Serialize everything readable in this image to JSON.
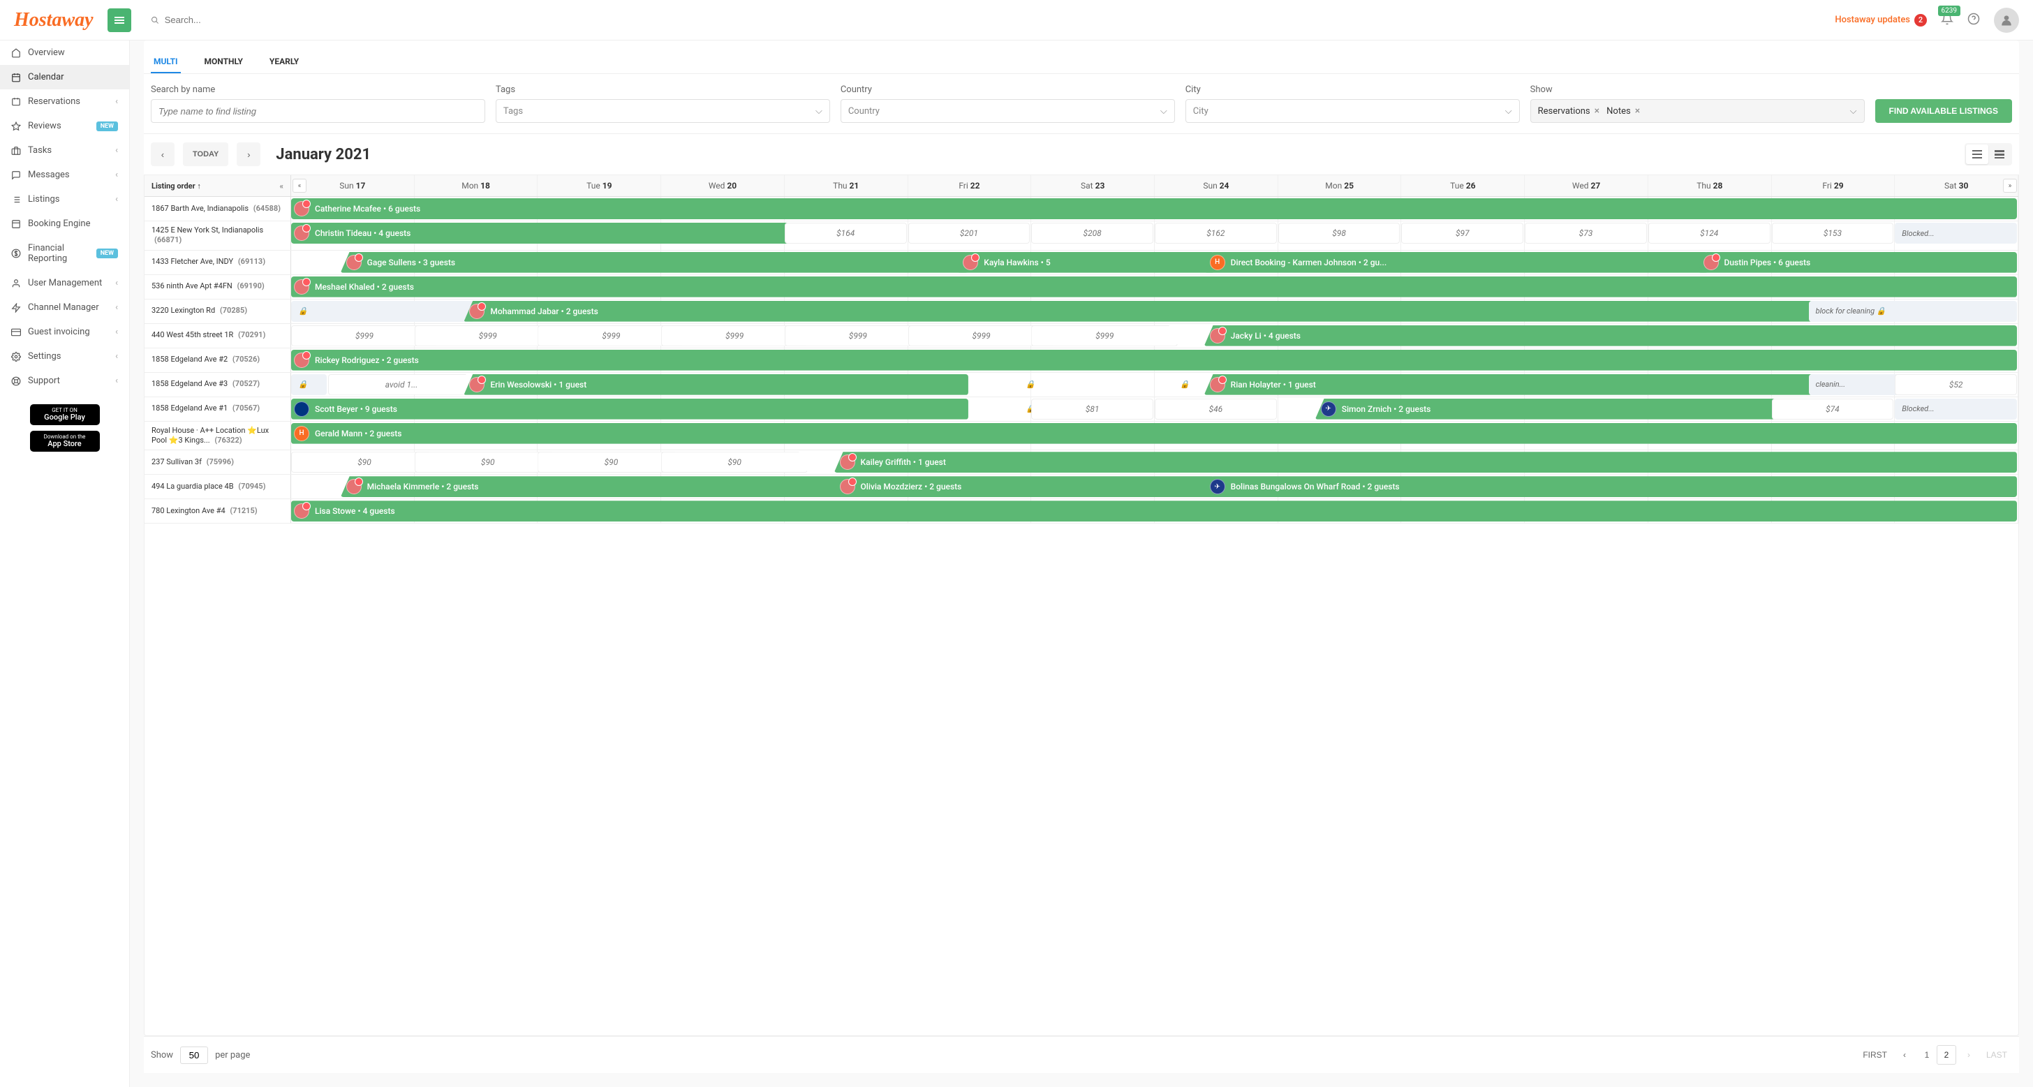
{
  "header": {
    "logo": "Hostaway",
    "search_placeholder": "Search...",
    "updates_label": "Hostaway updates",
    "updates_count": "2",
    "notif_count": "6239"
  },
  "sidebar": {
    "items": [
      {
        "label": "Overview",
        "icon": "home"
      },
      {
        "label": "Calendar",
        "icon": "calendar",
        "active": true
      },
      {
        "label": "Reservations",
        "icon": "book",
        "chevron": true
      },
      {
        "label": "Reviews",
        "icon": "star",
        "badge": "NEW"
      },
      {
        "label": "Tasks",
        "icon": "briefcase",
        "chevron": true
      },
      {
        "label": "Messages",
        "icon": "message",
        "chevron": true
      },
      {
        "label": "Listings",
        "icon": "list",
        "chevron": true
      },
      {
        "label": "Booking Engine",
        "icon": "window"
      },
      {
        "label": "Financial Reporting",
        "icon": "dollar",
        "badge": "NEW"
      },
      {
        "label": "User Management",
        "icon": "user",
        "chevron": true
      },
      {
        "label": "Channel Manager",
        "icon": "bolt",
        "chevron": true
      },
      {
        "label": "Guest invoicing",
        "icon": "card",
        "chevron": true
      },
      {
        "label": "Settings",
        "icon": "gear",
        "chevron": true
      },
      {
        "label": "Support",
        "icon": "life",
        "chevron": true
      }
    ],
    "google_play": "Google Play",
    "google_play_sub": "GET IT ON",
    "app_store": "App Store",
    "app_store_sub": "Download on the"
  },
  "tabs": [
    {
      "label": "MULTI",
      "active": true
    },
    {
      "label": "MONTHLY"
    },
    {
      "label": "YEARLY"
    }
  ],
  "filters": {
    "search_label": "Search by name",
    "search_placeholder": "Type name to find listing",
    "tags_label": "Tags",
    "tags_placeholder": "Tags",
    "country_label": "Country",
    "country_placeholder": "Country",
    "city_label": "City",
    "city_placeholder": "City",
    "show_label": "Show",
    "show_chips": [
      "Reservations",
      "Notes"
    ],
    "find_button": "FIND AVAILABLE LISTINGS"
  },
  "calendar": {
    "today_button": "TODAY",
    "title": "January 2021",
    "listing_header": "Listing order ↑",
    "dates": [
      {
        "dow": "Sun",
        "day": "17"
      },
      {
        "dow": "Mon",
        "day": "18"
      },
      {
        "dow": "Tue",
        "day": "19"
      },
      {
        "dow": "Wed",
        "day": "20"
      },
      {
        "dow": "Thu",
        "day": "21"
      },
      {
        "dow": "Fri",
        "day": "22"
      },
      {
        "dow": "Sat",
        "day": "23"
      },
      {
        "dow": "Sun",
        "day": "24"
      },
      {
        "dow": "Mon",
        "day": "25"
      },
      {
        "dow": "Tue",
        "day": "26"
      },
      {
        "dow": "Wed",
        "day": "27"
      },
      {
        "dow": "Thu",
        "day": "28"
      },
      {
        "dow": "Fri",
        "day": "29"
      },
      {
        "dow": "Sat",
        "day": "30"
      }
    ],
    "rows": [
      {
        "listing": "1867 Barth Ave, Indianapolis",
        "id": "(64588)",
        "items": [
          {
            "type": "booking",
            "start": 0,
            "span": 14,
            "label": "Catherine Mcafee • 6 guests",
            "startBefore": true
          }
        ]
      },
      {
        "listing": "1425 E New York St, Indianapolis",
        "id": "(66871)",
        "items": [
          {
            "type": "booking",
            "start": 0,
            "span": 4.5,
            "label": "Christin Tideau • 4 guests",
            "startBefore": true
          },
          {
            "type": "price",
            "start": 4,
            "span": 1,
            "label": "$164",
            "plain": true
          },
          {
            "type": "price",
            "start": 5,
            "span": 1,
            "label": "$201",
            "plain": true
          },
          {
            "type": "price",
            "start": 6,
            "span": 1,
            "label": "$208",
            "plain": true
          },
          {
            "type": "price",
            "start": 7,
            "span": 1,
            "label": "$162",
            "plain": true
          },
          {
            "type": "price",
            "start": 8,
            "span": 1,
            "label": "$98",
            "plain": true
          },
          {
            "type": "price",
            "start": 9,
            "span": 1,
            "label": "$97",
            "plain": true
          },
          {
            "type": "price",
            "start": 10,
            "span": 1,
            "label": "$73",
            "plain": true
          },
          {
            "type": "price",
            "start": 11,
            "span": 1,
            "label": "$124",
            "plain": true
          },
          {
            "type": "price",
            "start": 12,
            "span": 1,
            "label": "$153",
            "plain": true
          },
          {
            "type": "note",
            "start": 13,
            "span": 1,
            "label": "Blocked..."
          }
        ]
      },
      {
        "listing": "1433 Fletcher Ave, INDY",
        "id": "(69113)",
        "items": [
          {
            "type": "booking",
            "start": 0.4,
            "span": 5.1,
            "label": "Gage Sullens • 3 guests"
          },
          {
            "type": "booking",
            "start": 5.4,
            "span": 2.1,
            "label": "Kayla Hawkins • 5"
          },
          {
            "type": "booking",
            "start": 7.4,
            "span": 4.1,
            "label": "Direct Booking - Karmen Johnson • 2 gu...",
            "avatar": "h"
          },
          {
            "type": "booking",
            "start": 11.4,
            "span": 2.6,
            "label": "Dustin Pipes • 6 guests"
          }
        ]
      },
      {
        "listing": "536 ninth Ave Apt #4FN",
        "id": "(69190)",
        "items": [
          {
            "type": "booking",
            "start": 0,
            "span": 14,
            "label": "Meshael Khaled • 2 guests",
            "startBefore": true
          }
        ]
      },
      {
        "listing": "3220 Lexington Rd",
        "id": "(70285)",
        "items": [
          {
            "type": "note",
            "start": 0,
            "span": 1.5,
            "label": "🔒"
          },
          {
            "type": "booking",
            "start": 1.4,
            "span": 10.95,
            "label": "Mohammad Jabar • 2 guests"
          },
          {
            "type": "note",
            "start": 12.3,
            "span": 1.7,
            "label": "block for cleaning  🔒"
          }
        ]
      },
      {
        "listing": "440 West 45th street 1R",
        "id": "(70291)",
        "items": [
          {
            "type": "price",
            "start": 0,
            "span": 1.2,
            "label": "$999"
          },
          {
            "type": "price",
            "start": 1,
            "span": 1.2,
            "label": "$999"
          },
          {
            "type": "price",
            "start": 2,
            "span": 1.2,
            "label": "$999"
          },
          {
            "type": "price",
            "start": 3,
            "span": 1.2,
            "label": "$999"
          },
          {
            "type": "price",
            "start": 4,
            "span": 1.2,
            "label": "$999"
          },
          {
            "type": "price",
            "start": 5,
            "span": 1.2,
            "label": "$999"
          },
          {
            "type": "price",
            "start": 6,
            "span": 1.2,
            "label": "$999"
          },
          {
            "type": "booking",
            "start": 7.4,
            "span": 6.6,
            "label": "Jacky Li • 4 guests"
          }
        ]
      },
      {
        "listing": "1858 Edgeland Ave #2",
        "id": "(70526)",
        "items": [
          {
            "type": "booking",
            "start": 0,
            "span": 14,
            "label": "Rickey Rodriguez • 2 guests",
            "startBefore": true
          }
        ]
      },
      {
        "listing": "1858 Edgeland Ave #3",
        "id": "(70527)",
        "items": [
          {
            "type": "note",
            "start": 0,
            "span": 0.3,
            "label": "🔒"
          },
          {
            "type": "price",
            "start": 0.3,
            "span": 1.2,
            "label": "avoid 1..."
          },
          {
            "type": "booking",
            "start": 1.4,
            "span": 4.1,
            "label": "Erin Wesolowski • 1 guest"
          },
          {
            "type": "note",
            "start": 5.5,
            "span": 1,
            "label": "🔒",
            "plain": true
          },
          {
            "type": "note",
            "start": 7,
            "span": 0.5,
            "label": "🔒",
            "plain": true
          },
          {
            "type": "booking",
            "start": 7.4,
            "span": 4.95,
            "label": "Rian Holayter • 1 guest"
          },
          {
            "type": "note",
            "start": 12.3,
            "span": 0.8,
            "label": "cleanin..."
          },
          {
            "type": "price",
            "start": 13,
            "span": 1,
            "label": "$52",
            "plain": true
          }
        ]
      },
      {
        "listing": "1858 Edgeland Ave #1",
        "id": "(70567)",
        "items": [
          {
            "type": "booking",
            "start": 0,
            "span": 5.5,
            "label": "Scott Beyer • 9 guests",
            "startBefore": true,
            "avatar": "ex"
          },
          {
            "type": "note",
            "start": 5.5,
            "span": 1,
            "label": "🔒",
            "plain": true
          },
          {
            "type": "price",
            "start": 6,
            "span": 1,
            "label": "$81",
            "plain": true
          },
          {
            "type": "price",
            "start": 7,
            "span": 1,
            "label": "$46",
            "plain": true
          },
          {
            "type": "booking",
            "start": 8.3,
            "span": 4,
            "label": "Simon Zrnich • 2 guests",
            "avatar": "blue"
          },
          {
            "type": "price",
            "start": 12,
            "span": 1,
            "label": "$74",
            "plain": true
          },
          {
            "type": "note",
            "start": 13,
            "span": 1,
            "label": "Blocked..."
          }
        ]
      },
      {
        "listing": "Royal House · A++ Location ⭐Lux Pool ⭐3 Kings...",
        "id": "(76322)",
        "items": [
          {
            "type": "booking",
            "start": 0,
            "span": 14,
            "label": "Gerald Mann • 2 guests",
            "startBefore": true,
            "avatar": "h"
          }
        ]
      },
      {
        "listing": "237 Sullivan 3f",
        "id": "(75996)",
        "items": [
          {
            "type": "price",
            "start": 0,
            "span": 1.2,
            "label": "$90"
          },
          {
            "type": "price",
            "start": 1,
            "span": 1.2,
            "label": "$90"
          },
          {
            "type": "price",
            "start": 2,
            "span": 1.2,
            "label": "$90"
          },
          {
            "type": "price",
            "start": 3,
            "span": 1.2,
            "label": "$90"
          },
          {
            "type": "booking",
            "start": 4.4,
            "span": 9.6,
            "label": "Kailey Griffith • 1 guest"
          }
        ]
      },
      {
        "listing": "494 La guardia place 4B",
        "id": "(70945)",
        "items": [
          {
            "type": "booking",
            "start": 0.4,
            "span": 4.1,
            "label": "Michaela Kimmerle • 2 guests"
          },
          {
            "type": "booking",
            "start": 4.4,
            "span": 3.1,
            "label": "Olivia Mozdzierz • 2 guests"
          },
          {
            "type": "booking",
            "start": 7.4,
            "span": 6.6,
            "label": "Bolinas Bungalows On Wharf Road • 2 guests",
            "avatar": "blue"
          }
        ]
      },
      {
        "listing": "780 Lexington Ave #4",
        "id": "(71215)",
        "items": [
          {
            "type": "booking",
            "start": 0,
            "span": 14,
            "label": "Lisa Stowe • 4 guests",
            "startBefore": true
          }
        ]
      }
    ]
  },
  "footer": {
    "show_label": "Show",
    "per_page_value": "50",
    "per_page_label": "per page",
    "first": "FIRST",
    "last": "LAST",
    "pages": [
      "1",
      "2"
    ],
    "active_page": "2"
  }
}
